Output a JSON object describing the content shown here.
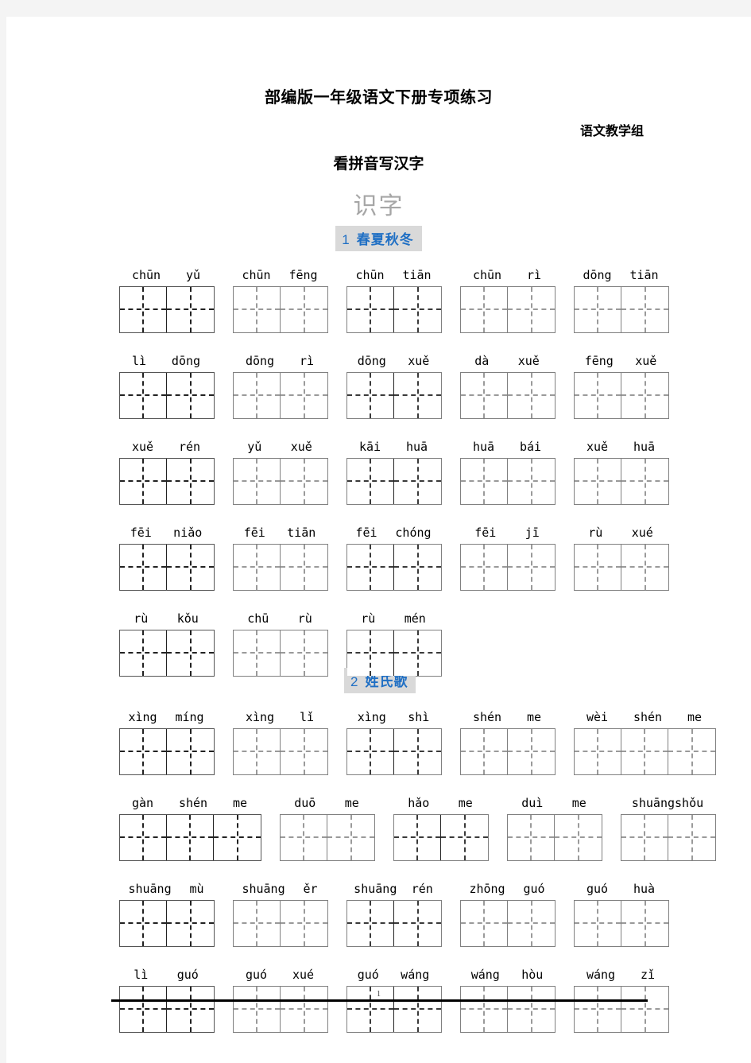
{
  "header": {
    "doc_title": "部编版一年级语文下册专项练习",
    "byline": "语文教学组",
    "sub_title": "看拼音写汉字",
    "unit_title": "识字"
  },
  "footer": {
    "page_number": "1"
  },
  "colors": {
    "section_head_text": "#1f6fc4",
    "section_head_bg": "#d9d9d9",
    "unit_title": "#a6a6a6",
    "page_bg": "#ffffff",
    "canvas_bg": "#f4f4f4"
  },
  "sections": [
    {
      "number": "1",
      "title": "春夏秋冬",
      "rows": [
        [
          {
            "pinyin": [
              "chūn",
              "yǔ"
            ],
            "cells": 2
          },
          {
            "pinyin": [
              "chūn",
              "fēng"
            ],
            "cells": 2
          },
          {
            "pinyin": [
              "chūn",
              "tiān"
            ],
            "cells": 2
          },
          {
            "pinyin": [
              "chūn",
              "rì"
            ],
            "cells": 2
          },
          {
            "pinyin": [
              "dōng",
              "tiān"
            ],
            "cells": 2
          }
        ],
        [
          {
            "pinyin": [
              "lì",
              "dōng"
            ],
            "cells": 2
          },
          {
            "pinyin": [
              "dōng",
              "rì"
            ],
            "cells": 2
          },
          {
            "pinyin": [
              "dōng",
              "xuě"
            ],
            "cells": 2
          },
          {
            "pinyin": [
              "dà",
              "xuě"
            ],
            "cells": 2
          },
          {
            "pinyin": [
              "fēng",
              "xuě"
            ],
            "cells": 2
          }
        ],
        [
          {
            "pinyin": [
              "xuě",
              "rén"
            ],
            "cells": 2
          },
          {
            "pinyin": [
              "yǔ",
              "xuě"
            ],
            "cells": 2
          },
          {
            "pinyin": [
              "kāi",
              "huā"
            ],
            "cells": 2
          },
          {
            "pinyin": [
              "huā",
              "bái"
            ],
            "cells": 2
          },
          {
            "pinyin": [
              "xuě",
              "huā"
            ],
            "cells": 2
          }
        ],
        [
          {
            "pinyin": [
              "fēi",
              "niǎo"
            ],
            "cells": 2
          },
          {
            "pinyin": [
              "fēi",
              "tiān"
            ],
            "cells": 2
          },
          {
            "pinyin": [
              "fēi",
              "chóng"
            ],
            "cells": 2
          },
          {
            "pinyin": [
              "fēi",
              "jī"
            ],
            "cells": 2
          },
          {
            "pinyin": [
              "rù",
              "xué"
            ],
            "cells": 2
          }
        ],
        [
          {
            "pinyin": [
              "rù",
              "kǒu"
            ],
            "cells": 2
          },
          {
            "pinyin": [
              "chū",
              "rù"
            ],
            "cells": 2
          },
          {
            "pinyin": [
              "rù",
              "mén"
            ],
            "cells": 2
          }
        ]
      ]
    },
    {
      "number": "2",
      "title": "姓氏歌",
      "rows": [
        [
          {
            "pinyin": [
              "xìng",
              "míng"
            ],
            "cells": 2
          },
          {
            "pinyin": [
              "xìng",
              "lǐ"
            ],
            "cells": 2
          },
          {
            "pinyin": [
              "xìng",
              "shì"
            ],
            "cells": 2
          },
          {
            "pinyin": [
              "shén",
              "me"
            ],
            "cells": 2
          },
          {
            "pinyin": [
              "wèi",
              "shén",
              "me"
            ],
            "cells": 3
          }
        ],
        [
          {
            "pinyin": [
              "gàn",
              "shén",
              "me"
            ],
            "cells": 3
          },
          {
            "pinyin": [
              "duō",
              "me"
            ],
            "cells": 2
          },
          {
            "pinyin": [
              "hǎo",
              "me"
            ],
            "cells": 2
          },
          {
            "pinyin": [
              "duì",
              "me"
            ],
            "cells": 2
          },
          {
            "pinyin": [
              "shuāngshǒu"
            ],
            "cells": 2
          }
        ],
        [
          {
            "pinyin": [
              "shuāng",
              "mù"
            ],
            "cells": 2
          },
          {
            "pinyin": [
              "shuāng",
              "ěr"
            ],
            "cells": 2
          },
          {
            "pinyin": [
              "shuāng",
              "rén"
            ],
            "cells": 2
          },
          {
            "pinyin": [
              "zhōng",
              "guó"
            ],
            "cells": 2
          },
          {
            "pinyin": [
              "guó",
              "huà"
            ],
            "cells": 2
          }
        ],
        [
          {
            "pinyin": [
              "lì",
              "guó"
            ],
            "cells": 2
          },
          {
            "pinyin": [
              "guó",
              "xué"
            ],
            "cells": 2
          },
          {
            "pinyin": [
              "guó",
              "wáng"
            ],
            "cells": 2
          },
          {
            "pinyin": [
              "wáng",
              "hòu"
            ],
            "cells": 2
          },
          {
            "pinyin": [
              "wáng",
              "zǐ"
            ],
            "cells": 2
          }
        ]
      ]
    }
  ]
}
